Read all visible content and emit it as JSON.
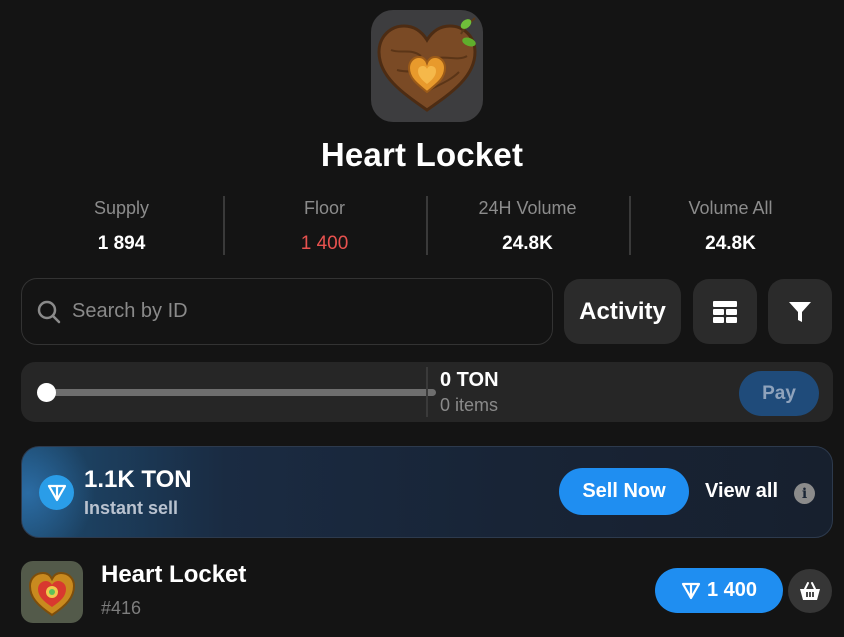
{
  "collection": {
    "title": "Heart Locket",
    "image_icon": "wooden-heart-icon"
  },
  "stats": [
    {
      "label": "Supply",
      "value": "1 894"
    },
    {
      "label": "Floor",
      "value": "1 400"
    },
    {
      "label": "24H Volume",
      "value": "24.8K"
    },
    {
      "label": "Volume All",
      "value": "24.8K"
    }
  ],
  "toolbar": {
    "search_placeholder": "Search by ID",
    "search_value": "",
    "activity_label": "Activity",
    "layout_icon": "grid-layout-icon",
    "filter_icon": "filter-icon"
  },
  "cart": {
    "slider_fraction": 0,
    "total": "0 TON",
    "items": "0 items",
    "pay_label": "Pay"
  },
  "banner": {
    "amount": "1.1K TON",
    "subtitle": "Instant sell",
    "sell_label": "Sell Now",
    "view_all_label": "View all",
    "info_glyph": "i"
  },
  "items": [
    {
      "name": "Heart Locket",
      "id": "#416",
      "price": "1 400"
    }
  ],
  "colors": {
    "background": "#141414",
    "accent": "#1f8ef1",
    "floor": "#e8524f",
    "panel": "#2b2b2b"
  }
}
